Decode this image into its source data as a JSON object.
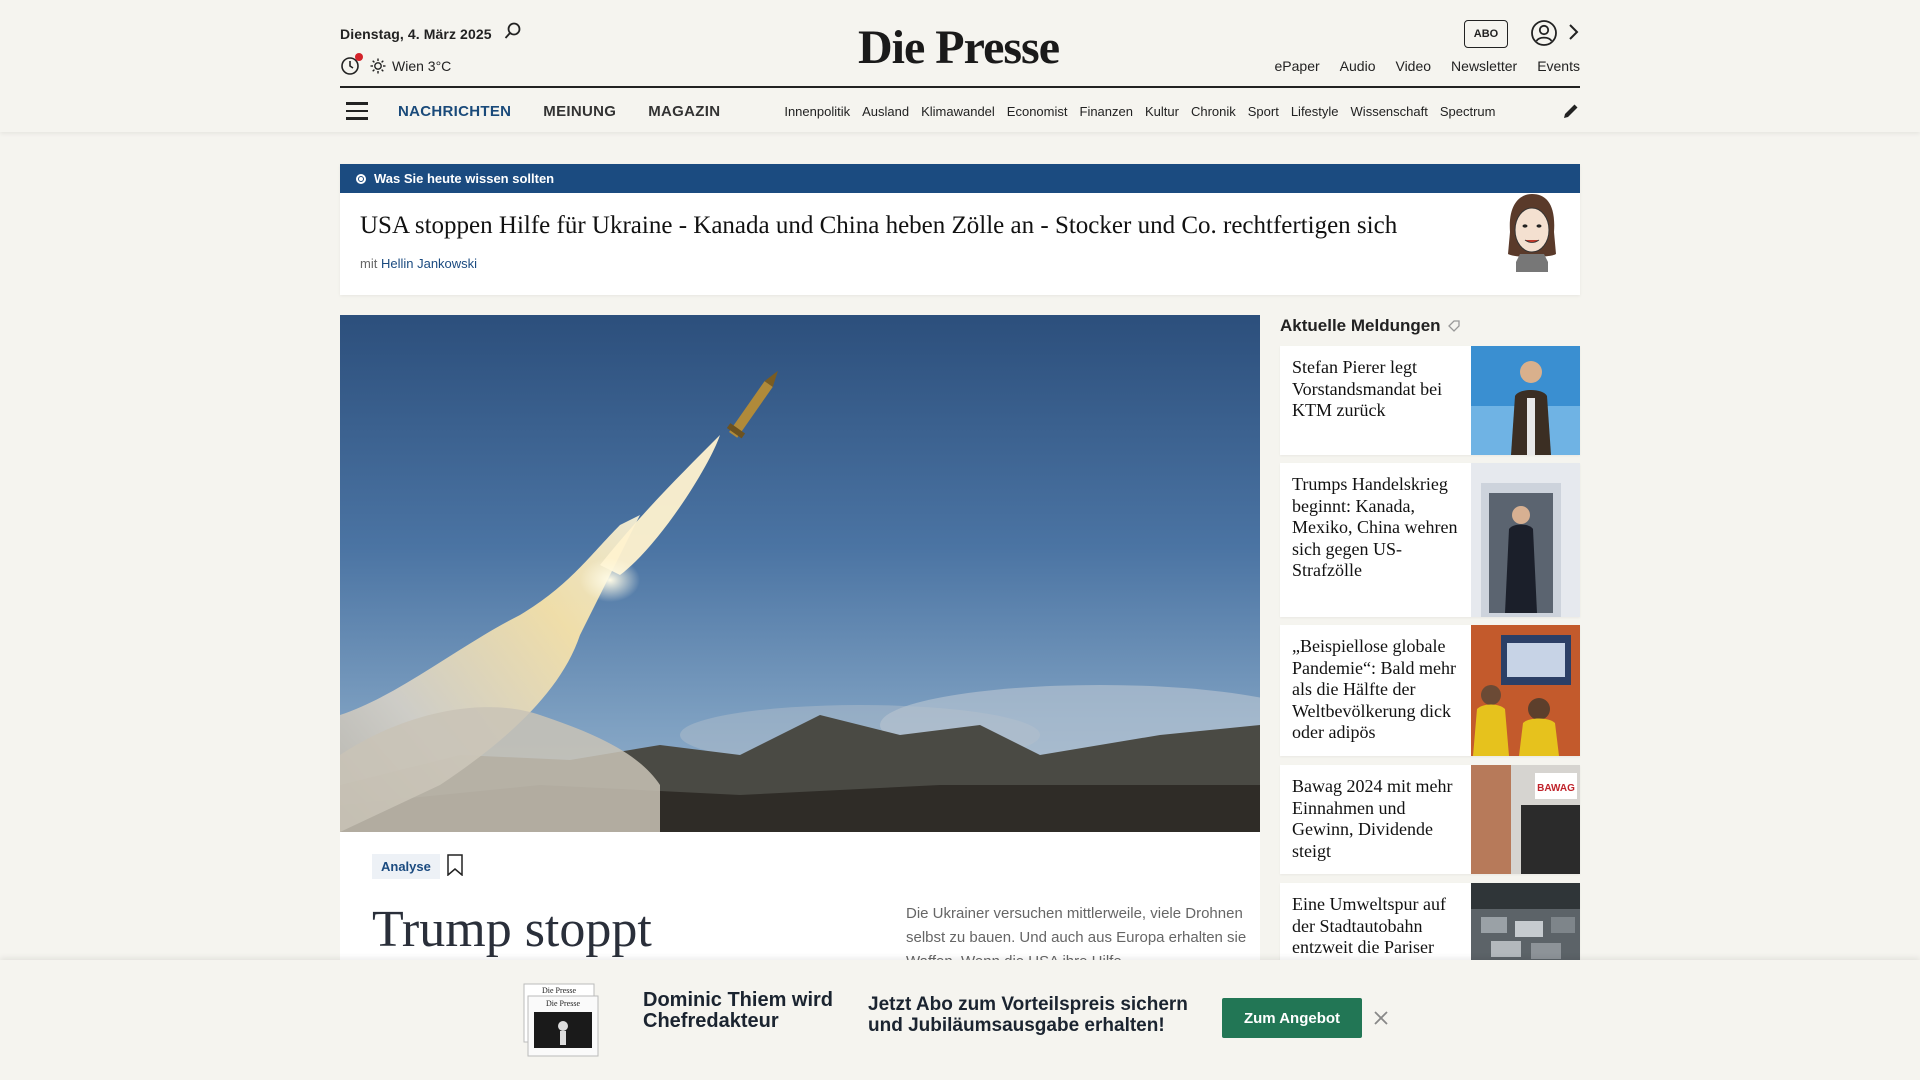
{
  "header": {
    "date": "Dienstag, 4. März 2025",
    "weather": "Wien 3°C",
    "logo": "Die Presse",
    "abo_label": "ABO",
    "top_links": [
      "ePaper",
      "Audio",
      "Video",
      "Newsletter",
      "Events"
    ],
    "main_nav": [
      "NACHRICHTEN",
      "MEINUNG",
      "MAGAZIN"
    ],
    "sub_nav": [
      "Innenpolitik",
      "Ausland",
      "Klimawandel",
      "Economist",
      "Finanzen",
      "Kultur",
      "Chronik",
      "Sport",
      "Lifestyle",
      "Wissenschaft",
      "Spectrum"
    ]
  },
  "banner": {
    "label": "Was Sie heute wissen sollten",
    "title": "USA stoppen Hilfe für Ukraine - Kanada und China heben Zölle an - Stocker und Co. rechtfertigen sich",
    "prefix": "mit",
    "author": "Hellin Jankowski"
  },
  "article": {
    "tag": "Analyse",
    "headline": "Trump stoppt",
    "lead": "Die Ukrainer versuchen mittlerweile, viele Drohnen selbst zu bauen. Und auch aus Europa erhalten sie Waffen. Wenn die USA ihre Hilfe"
  },
  "sidebar": {
    "title": "Aktuelle Meldungen",
    "items": [
      {
        "title": "Stefan Pierer legt Vorstandsmandat bei KTM zurück"
      },
      {
        "title": "Trumps Handelskrieg beginnt: Kanada, Mexiko, China wehren sich gegen US-Strafzölle"
      },
      {
        "title": "„Beispiellose globale Pandemie“: Bald mehr als die Hälfte der Weltbevölkerung dick oder adipös"
      },
      {
        "title": "Bawag 2024 mit mehr Einnahmen und Gewinn, Dividende steigt"
      },
      {
        "title": "Eine Umweltspur auf der Stadtautobahn entzweit die Pariser"
      }
    ]
  },
  "promo": {
    "name": "Dominic Thiem wird Chefredakteur",
    "offer": "Jetzt Abo zum Vorteilspreis sichern und Jubiläumsausgabe erhalten!",
    "button": "Zum Angebot",
    "paper_logo": "Die Presse"
  },
  "colors": {
    "brand_blue": "#1b4b80",
    "button_green": "#227655",
    "background": "#f5f4ef"
  }
}
